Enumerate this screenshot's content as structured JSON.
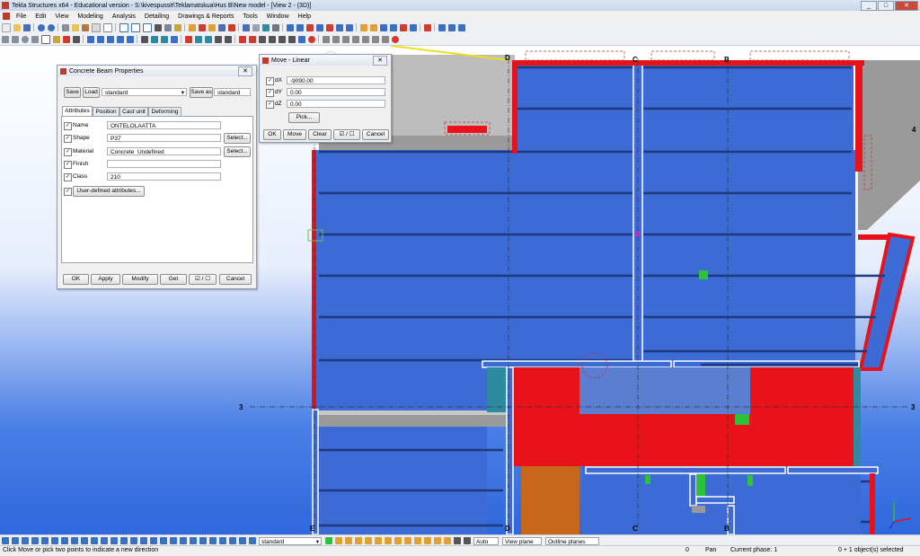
{
  "window": {
    "title": "Tekla Structures x64 - Educational version - S:\\kivespussit\\Teklamatskua\\Hus B\\New model - [View 2 - (3D)]"
  },
  "menu": [
    "File",
    "Edit",
    "View",
    "Modeling",
    "Analysis",
    "Detailing",
    "Drawings & Reports",
    "Tools",
    "Window",
    "Help"
  ],
  "beam_dialog": {
    "title": "Concrete Beam Properties",
    "save": "Save",
    "load": "Load",
    "preset": "standard",
    "save_as": "Save as",
    "save_as_name": "standard",
    "tabs": [
      "Attributes",
      "Position",
      "Cast unit",
      "Deforming"
    ],
    "fields": {
      "name_label": "Name",
      "name_value": "ONTELOLAATTA",
      "shape_label": "Shape",
      "shape_value": "P37",
      "material_label": "Material",
      "material_value": "Concrete_Undefined",
      "finish_label": "Finish",
      "finish_value": "",
      "class_label": "Class",
      "class_value": "210"
    },
    "select": "Select...",
    "udf": "User-defined attributes...",
    "buttons": {
      "ok": "OK",
      "apply": "Apply",
      "modify": "Modify",
      "get": "Get",
      "toggle": "☑ / ☐",
      "cancel": "Cancel"
    }
  },
  "move_dialog": {
    "title": "Move - Linear",
    "dx_label": "dX",
    "dx": "-9090.00",
    "dy_label": "dY",
    "dy": "0.00",
    "dz_label": "dZ",
    "dz": "0.00",
    "pick": "Pick...",
    "buttons": {
      "ok": "OK",
      "move": "Move",
      "clear": "Clear",
      "toggle": "☑ / ☐",
      "cancel": "Cancel"
    }
  },
  "grid_labels": {
    "d_top": "D",
    "c_top": "C",
    "b_top": "B",
    "four": "4",
    "three_left": "3",
    "three_right": "3",
    "e_bottom": "E",
    "d_bottom": "D",
    "c_bottom": "C",
    "b_bottom": "B"
  },
  "bottom_toolbar": {
    "filter": "standard",
    "snap": "Auto",
    "plane": "View plane",
    "outline": "Outline planes"
  },
  "status": {
    "prompt": "Click Move or pick two points to indicate a new direction",
    "count": "0",
    "mode": "Pan",
    "phase": "Current phase: 1",
    "selected": "0 + 1 object(s) selected"
  },
  "colors": {
    "slab": "#3d6bd6",
    "red": "#e8121a",
    "teal": "#2e8a9e",
    "orange": "#c8661a",
    "green": "#2ec23a",
    "grey": "#9a9a9a"
  }
}
